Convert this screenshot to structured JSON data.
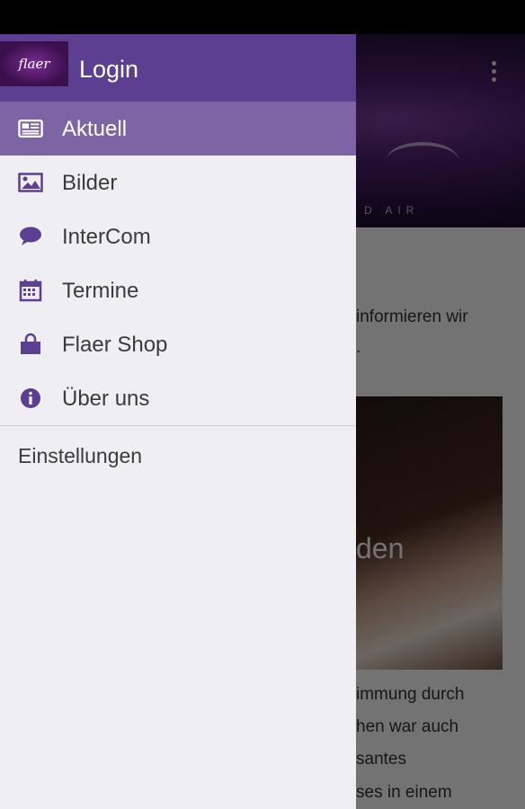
{
  "header": {
    "login_label": "Login",
    "logo_text": "flaer"
  },
  "menu": {
    "items": [
      {
        "label": "Aktuell",
        "icon": "newspaper-icon",
        "active": true
      },
      {
        "label": "Bilder",
        "icon": "image-icon",
        "active": false
      },
      {
        "label": "InterCom",
        "icon": "chat-bubble-icon",
        "active": false
      },
      {
        "label": "Termine",
        "icon": "calendar-icon",
        "active": false
      },
      {
        "label": "Flaer Shop",
        "icon": "shopping-bag-icon",
        "active": false
      },
      {
        "label": "Über uns",
        "icon": "info-icon",
        "active": false
      }
    ],
    "settings_label": "Einstellungen"
  },
  "background": {
    "tagline": "D AIR",
    "text_line_1": "informieren wir",
    "text_line_2": ".",
    "image_caption": "den",
    "paragraph": [
      "immung durch",
      "hen war auch",
      "santes",
      "ses in einem"
    ]
  },
  "colors": {
    "drawer_header": "#5c3f91",
    "active_item": "#7d65a5",
    "drawer_bg": "#efeef3",
    "icon_color": "#5c3f91"
  }
}
